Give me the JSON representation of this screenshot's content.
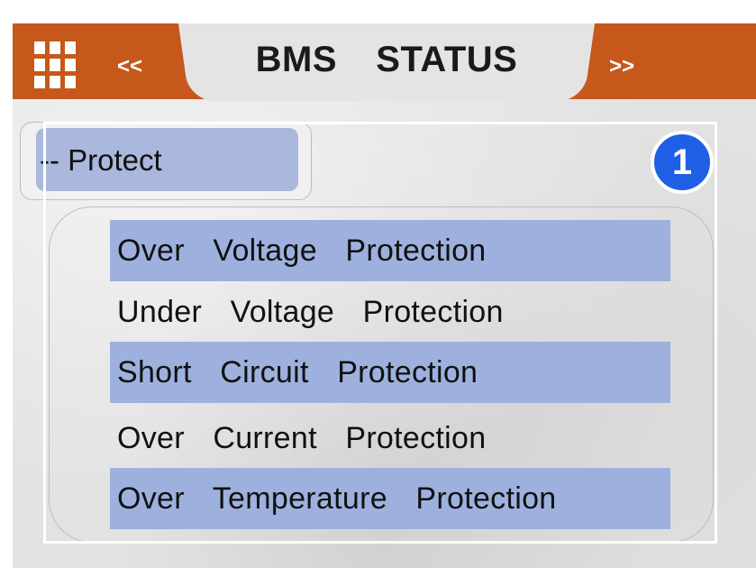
{
  "header": {
    "title": "BMS  STATUS",
    "prev_label": "<<",
    "next_label": ">>",
    "menu_icon": "grid-menu-icon"
  },
  "section": {
    "label": "-- Protect",
    "badge": "1"
  },
  "protections": [
    {
      "label": "Over  Voltage  Protection",
      "highlighted": true
    },
    {
      "label": "Under  Voltage  Protection",
      "highlighted": false
    },
    {
      "label": "Short  Circuit  Protection",
      "highlighted": true
    },
    {
      "label": "Over  Current  Protection",
      "highlighted": false
    },
    {
      "label": "Over  Temperature  Protection",
      "highlighted": true
    }
  ],
  "colors": {
    "header": "#c5581a",
    "highlight_row": "#9eb1de",
    "badge": "#1f5fe6"
  }
}
